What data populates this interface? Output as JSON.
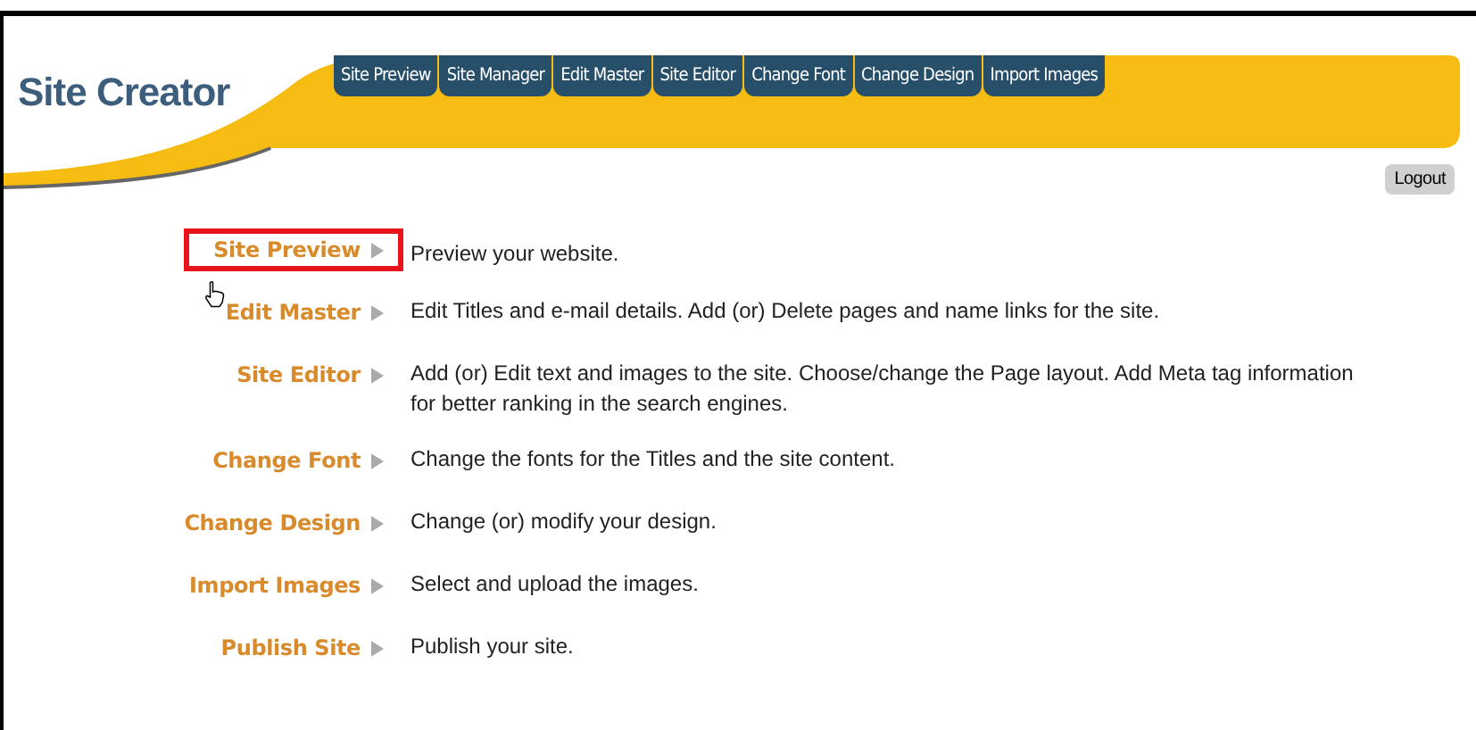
{
  "header": {
    "title": "Site Creator"
  },
  "tabs": [
    {
      "label": "Site Preview"
    },
    {
      "label": "Site Manager"
    },
    {
      "label": "Edit Master"
    },
    {
      "label": "Site Editor"
    },
    {
      "label": "Change Font"
    },
    {
      "label": "Change Design"
    },
    {
      "label": "Import Images"
    }
  ],
  "logout": {
    "label": "Logout"
  },
  "items": [
    {
      "label": "Site Preview",
      "description": "Preview your website.",
      "highlighted": true
    },
    {
      "label": "Edit Master",
      "description": "Edit Titles and e-mail details. Add (or) Delete pages and name links for the site.",
      "highlighted": false
    },
    {
      "label": "Site Editor",
      "description": "Add (or) Edit text and images to the site. Choose/change the Page layout. Add Meta tag information for better ranking in the search engines.",
      "highlighted": false
    },
    {
      "label": "Change Font",
      "description": "Change the fonts for the Titles and the site content.",
      "highlighted": false
    },
    {
      "label": "Change Design",
      "description": "Change (or) modify your design.",
      "highlighted": false
    },
    {
      "label": "Import Images",
      "description": "Select and upload the images.",
      "highlighted": false
    },
    {
      "label": "Publish Site",
      "description": "Publish your site.",
      "highlighted": false
    }
  ]
}
